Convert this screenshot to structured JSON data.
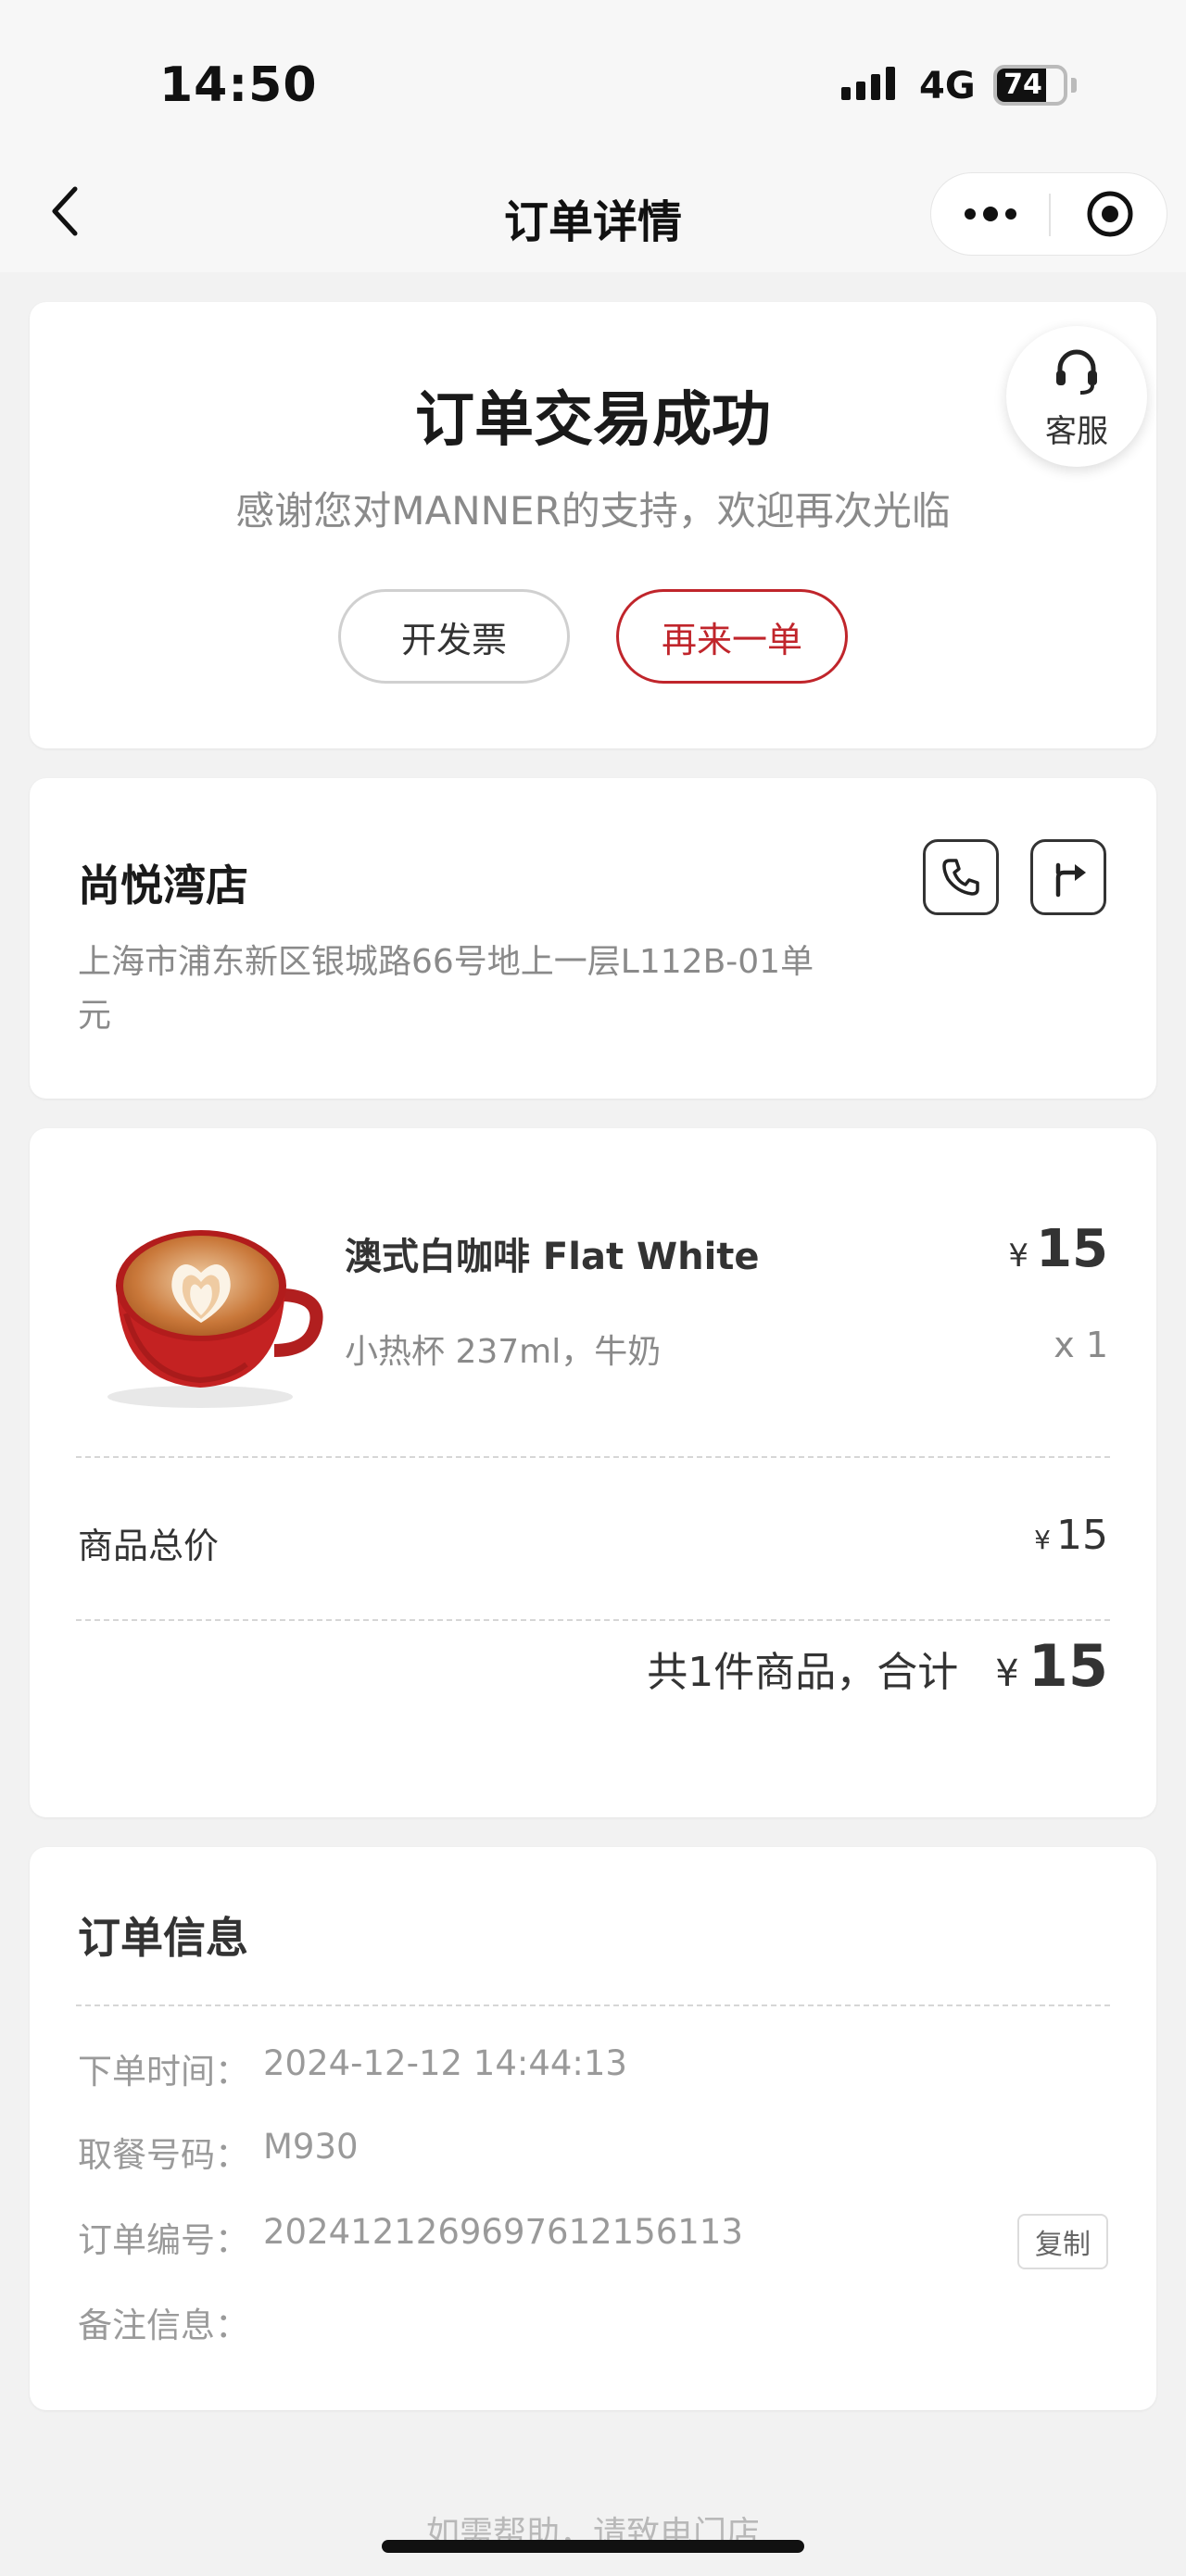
{
  "status_bar": {
    "time": "14:50",
    "network": "4G",
    "battery": "74"
  },
  "nav": {
    "title": "订单详情"
  },
  "order_status": {
    "title": "订单交易成功",
    "subtitle": "感谢您对MANNER的支持，欢迎再次光临",
    "invoice_button": "开发票",
    "reorder_button": "再来一单",
    "customer_service_label": "客服"
  },
  "store": {
    "name": "尚悦湾店",
    "address": "上海市浦东新区银城路66号地上一层L112B-01单元"
  },
  "product": {
    "image_icon": "latte-cup-image",
    "name": "澳式白咖啡 Flat White",
    "spec": "小热杯 237ml，牛奶",
    "currency": "¥",
    "price": "15",
    "qty": "x 1"
  },
  "summary": {
    "subtotal_label": "商品总价",
    "subtotal_currency": "¥",
    "subtotal_value": "15",
    "total_text": "共1件商品，合计",
    "total_currency": "¥",
    "total_value": "15"
  },
  "order_info": {
    "title": "订单信息",
    "rows": [
      {
        "label": "下单时间：",
        "value": "2024-12-12 14:44:13"
      },
      {
        "label": "取餐号码：",
        "value": "M930"
      },
      {
        "label": "订单编号：",
        "value": "20241212696976121561​13"
      },
      {
        "label": "备注信息：",
        "value": ""
      }
    ],
    "copy_button": "复制"
  },
  "footer": {
    "note": "如需帮助，请致电门店"
  },
  "colors": {
    "accent": "#c0252b",
    "background": "#f2f2f2",
    "card": "#ffffff"
  }
}
